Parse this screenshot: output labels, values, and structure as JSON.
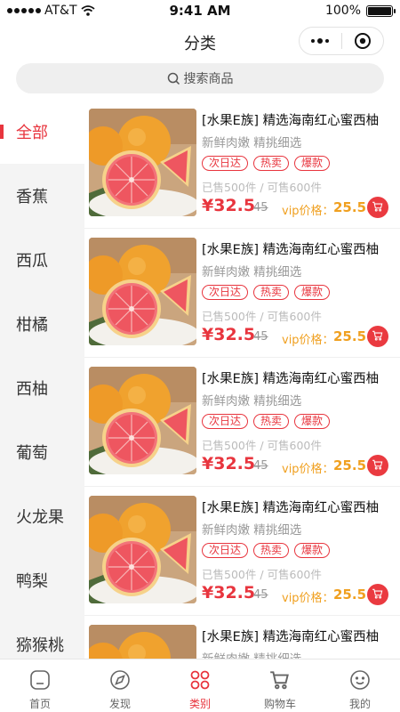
{
  "status_bar": {
    "carrier": "AT&T",
    "time": "9:41 AM",
    "battery": "100%",
    "battery_level": 1.0
  },
  "nav": {
    "title": "分类"
  },
  "search": {
    "placeholder": "搜索商品"
  },
  "sidebar": {
    "items": [
      {
        "label": "全部",
        "active": true
      },
      {
        "label": "香蕉"
      },
      {
        "label": "西瓜"
      },
      {
        "label": "柑橘"
      },
      {
        "label": "西柚"
      },
      {
        "label": "葡萄"
      },
      {
        "label": "火龙果"
      },
      {
        "label": "鸭梨"
      },
      {
        "label": "猕猴桃"
      }
    ]
  },
  "products": [
    {
      "title": "[水果E族] 精选海南红心蜜西柚",
      "subtitle": "新鲜肉嫩 精挑细选",
      "tags": [
        "次日达",
        "热卖",
        "爆款"
      ],
      "sold": "已售500件 / 可售600件",
      "price": "¥32.5",
      "old_price": "45",
      "vip_label": "vip价格：",
      "vip_price": "25.5"
    },
    {
      "title": "[水果E族] 精选海南红心蜜西柚",
      "subtitle": "新鲜肉嫩 精挑细选",
      "tags": [
        "次日达",
        "热卖",
        "爆款"
      ],
      "sold": "已售500件 / 可售600件",
      "price": "¥32.5",
      "old_price": "45",
      "vip_label": "vip价格：",
      "vip_price": "25.5"
    },
    {
      "title": "[水果E族] 精选海南红心蜜西柚",
      "subtitle": "新鲜肉嫩 精挑细选",
      "tags": [
        "次日达",
        "热卖",
        "爆款"
      ],
      "sold": "已售500件 / 可售600件",
      "price": "¥32.5",
      "old_price": "45",
      "vip_label": "vip价格：",
      "vip_price": "25.5"
    },
    {
      "title": "[水果E族] 精选海南红心蜜西柚",
      "subtitle": "新鲜肉嫩 精挑细选",
      "tags": [
        "次日达",
        "热卖",
        "爆款"
      ],
      "sold": "已售500件 / 可售600件",
      "price": "¥32.5",
      "old_price": "45",
      "vip_label": "vip价格：",
      "vip_price": "25.5"
    },
    {
      "title": "[水果E族] 精选海南红心蜜西柚",
      "subtitle": "新鲜肉嫩 精挑细选"
    }
  ],
  "tabbar": {
    "items": [
      {
        "label": "首页",
        "icon": "home-icon"
      },
      {
        "label": "发现",
        "icon": "compass-icon"
      },
      {
        "label": "类别",
        "icon": "category-icon",
        "active": true
      },
      {
        "label": "购物车",
        "icon": "cart-icon"
      },
      {
        "label": "我的",
        "icon": "smile-icon"
      }
    ]
  },
  "colors": {
    "accent": "#e8353e",
    "vip": "#f0a020"
  }
}
